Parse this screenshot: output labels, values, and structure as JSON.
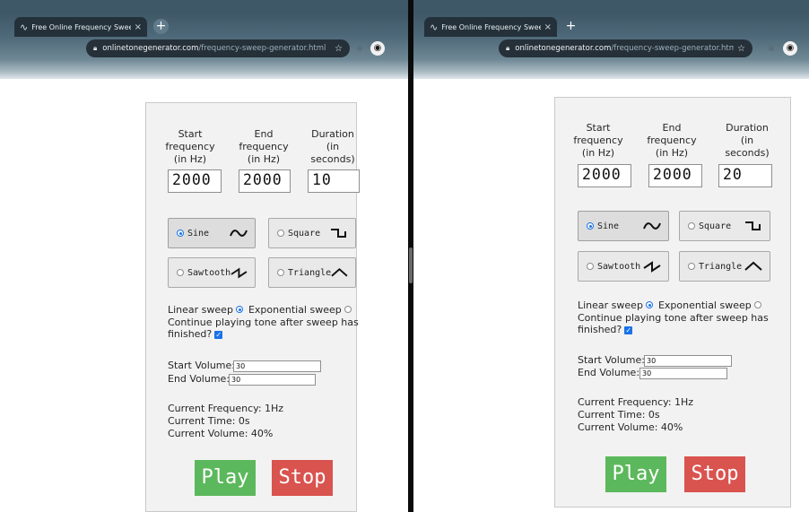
{
  "browser": {
    "tab_title": "Free Online Frequency Sweep",
    "tab_close": "×",
    "new_tab": "+",
    "url_host": "onlinetonegenerator.com",
    "url_path": "/frequency-sweep-generator.html"
  },
  "form": {
    "start_freq_label": [
      "Start",
      "frequency",
      "(in Hz)"
    ],
    "end_freq_label": [
      "End",
      "frequency",
      "(in Hz)"
    ],
    "duration_label": [
      "Duration",
      "(in",
      "seconds)"
    ],
    "waveforms": [
      "Sine",
      "Square",
      "Sawtooth",
      "Triangle"
    ],
    "selected_waveform": "Sine",
    "linear_sweep_label": "Linear sweep",
    "exponential_sweep_label": "Exponential sweep",
    "selected_sweep": "Linear sweep",
    "continue_label_1": "Continue playing tone after sweep has",
    "continue_label_2": "finished?",
    "continue_checked": true,
    "start_volume_label": "Start Volume:",
    "end_volume_label": "End Volume:",
    "current_frequency": "Current Frequency: 1Hz",
    "current_time": "Current Time: 0s",
    "current_volume": "Current Volume: 40%",
    "play_label": "Play",
    "stop_label": "Stop"
  },
  "left_window": {
    "start_frequency": "2000",
    "end_frequency": "2000",
    "duration": "10",
    "start_volume": "30",
    "end_volume": "30"
  },
  "right_window": {
    "start_frequency": "2000",
    "end_frequency": "2000",
    "duration": "20",
    "start_volume": "30",
    "end_volume": "30"
  },
  "colors": {
    "play": "#5cb85c",
    "stop": "#d9534f",
    "radio_selected": "#1a73e8",
    "browser_toolbar": "#3f5868"
  },
  "icons": {
    "tab_favicon": "sine-wave-icon",
    "lock": "lock-icon",
    "bookmark": "star-icon",
    "extension": "extension-icon"
  }
}
